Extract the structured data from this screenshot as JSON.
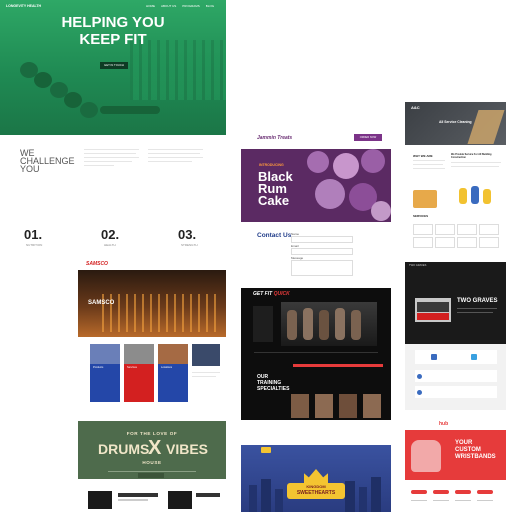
{
  "hero": {
    "logo": "LONGEVITY HEALTH",
    "nav": [
      "HOME",
      "ABOUT US",
      "PROGRAMS",
      "BLOG"
    ],
    "title_line1": "HELPING YOU",
    "title_line2": "KEEP FIT",
    "cta": "GET IN TOUCH",
    "challenge_line1": "WE",
    "challenge_line2": "CHALLENGE",
    "challenge_line3": "YOU",
    "steps": [
      {
        "number": "01.",
        "label": "NUTRITION"
      },
      {
        "number": "02.",
        "label": "HEALTH"
      },
      {
        "number": "03.",
        "label": "STRENGTH"
      }
    ]
  },
  "cake": {
    "logo": "Jammin Treats",
    "button": "ORDER NOW",
    "kicker": "INTRODUCING",
    "title_line1": "Black",
    "title_line2": "Rum",
    "title_line3": "Cake"
  },
  "contact": {
    "title": "Contact Us",
    "fields": [
      "Name",
      "Email",
      "Message"
    ]
  },
  "cleaning": {
    "logo": "A&C",
    "title": "All Service Cleaning",
    "why_heading": "WHY WE ARE",
    "services_heading": "SERVICES",
    "provider_heading": "We Provide Service For All Building Construction"
  },
  "samsco": {
    "logo": "SAMSCO",
    "hero": "SAMSCO",
    "cards": [
      "Products",
      "Services",
      "Locations"
    ]
  },
  "fitness": {
    "logo": "GET FIT",
    "logo_accent": "QUICK",
    "section_line1": "OUR",
    "section_line2": "TRAINING",
    "section_line3": "SPECIALTIES"
  },
  "graves": {
    "logo": "TWO GRAVES",
    "title": "TWO GRAVES"
  },
  "drums": {
    "top": "FOR THE LOVE OF",
    "left": "DRUMS",
    "right": "VIBES",
    "bottom": "HOUSE"
  },
  "kingdom": {
    "name": "KINGDOM",
    "subtitle": "SWEETHEARTS"
  },
  "wristbands": {
    "logo": "hub",
    "line1": "YOUR",
    "line2": "CUSTOM",
    "line3": "WRISTBANDS"
  },
  "colors": {
    "green": "#25915a",
    "purple": "#5b2a63",
    "black": "#0d0d0d",
    "drums_green": "#4e6b4c",
    "navy": "#2a3c80",
    "red": "#e63b3b"
  }
}
